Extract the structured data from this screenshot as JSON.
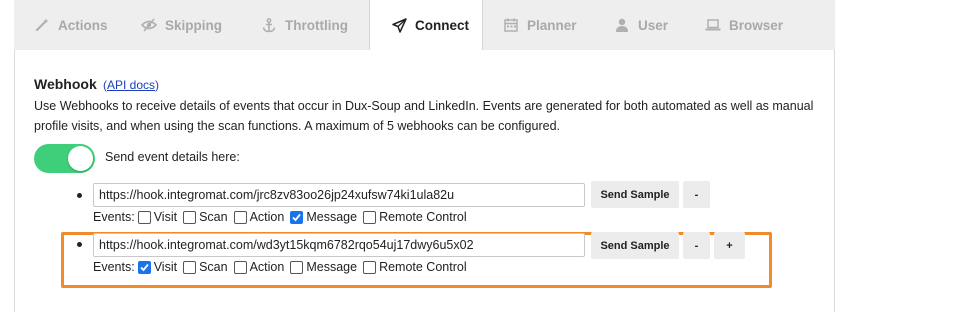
{
  "tabs": [
    {
      "label": "Actions",
      "icon": "wand-icon"
    },
    {
      "label": "Skipping",
      "icon": "eye-slash-icon"
    },
    {
      "label": "Throttling",
      "icon": "anchor-icon"
    },
    {
      "label": "Connect",
      "icon": "paper-plane-icon",
      "active": true
    },
    {
      "label": "Planner",
      "icon": "calendar-icon"
    },
    {
      "label": "User",
      "icon": "user-icon"
    },
    {
      "label": "Browser",
      "icon": "laptop-icon"
    }
  ],
  "webhook": {
    "title": "Webhook",
    "api_open": "(",
    "api_link": "API docs",
    "api_close": ")",
    "description": "Use Webhooks to receive details of events that occur in Dux-Soup and LinkedIn. Events are generated for both automated as well as manual profile visits, and when using the scan functions. A maximum of 5 webhooks can be configured.",
    "toggle_on": true,
    "toggle_label": "Send event details here:",
    "events_label": "Events:",
    "send_sample_label": "Send Sample",
    "remove_label": "-",
    "add_label": "+",
    "accent_color": "#3fcf7a",
    "highlight_color": "#f08a2b",
    "hooks": [
      {
        "url": "https://hook.integromat.com/jrc8zv83oo26jp24xufsw74ki1ula82u",
        "events": [
          {
            "label": "Visit",
            "checked": false
          },
          {
            "label": "Scan",
            "checked": false
          },
          {
            "label": "Action",
            "checked": false
          },
          {
            "label": "Message",
            "checked": true
          },
          {
            "label": "Remote Control",
            "checked": false
          }
        ]
      },
      {
        "url": "https://hook.integromat.com/wd3yt15kqm6782rqo54uj17dwy6u5x02",
        "events": [
          {
            "label": "Visit",
            "checked": true
          },
          {
            "label": "Scan",
            "checked": false
          },
          {
            "label": "Action",
            "checked": false
          },
          {
            "label": "Message",
            "checked": false
          },
          {
            "label": "Remote Control",
            "checked": false
          }
        ]
      }
    ]
  }
}
